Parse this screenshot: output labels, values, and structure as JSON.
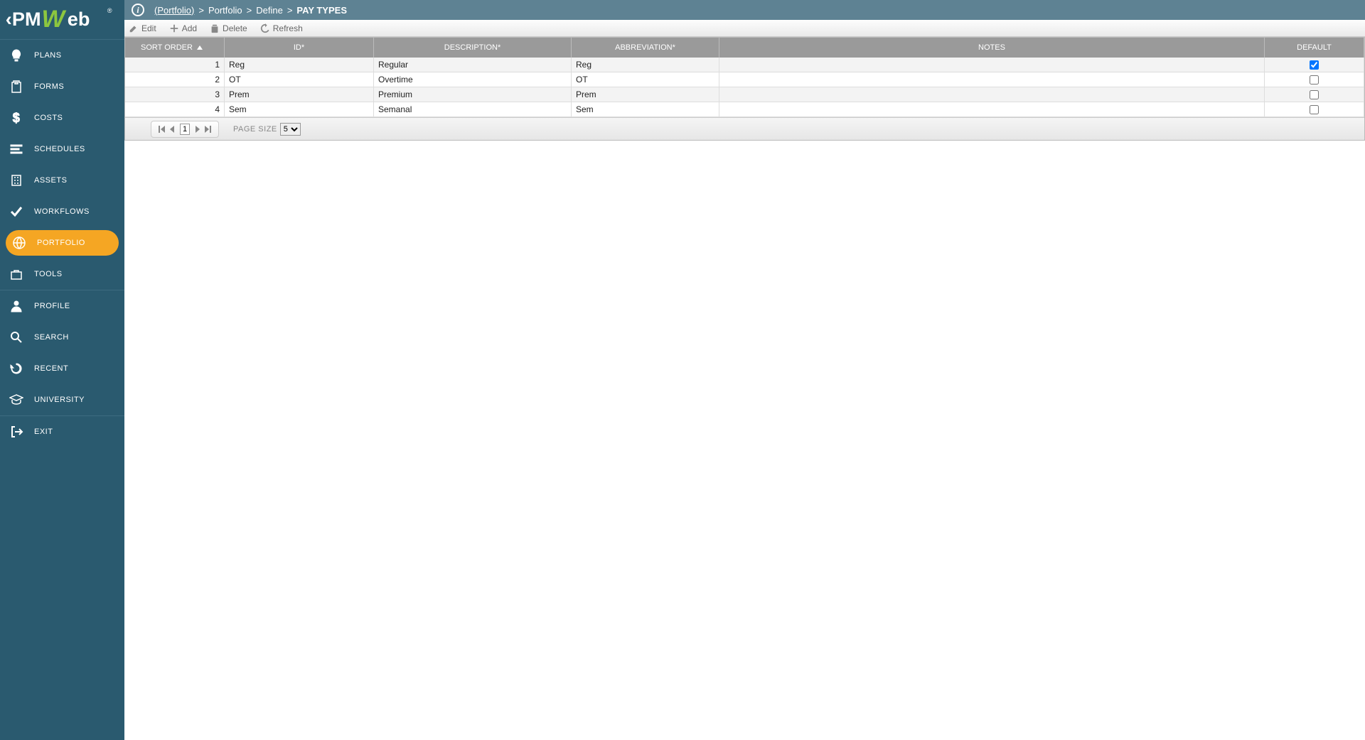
{
  "logo": {
    "brand": "PMWeb"
  },
  "sidebar": {
    "groups": [
      {
        "items": [
          {
            "label": "PLANS",
            "icon": "bulb"
          },
          {
            "label": "FORMS",
            "icon": "clipboard"
          },
          {
            "label": "COSTS",
            "icon": "dollar"
          },
          {
            "label": "SCHEDULES",
            "icon": "bars"
          },
          {
            "label": "ASSETS",
            "icon": "building"
          },
          {
            "label": "WORKFLOWS",
            "icon": "check"
          },
          {
            "label": "PORTFOLIO",
            "icon": "globe",
            "active": true
          },
          {
            "label": "TOOLS",
            "icon": "briefcase"
          }
        ]
      },
      {
        "items": [
          {
            "label": "PROFILE",
            "icon": "person"
          },
          {
            "label": "SEARCH",
            "icon": "search"
          },
          {
            "label": "RECENT",
            "icon": "history"
          },
          {
            "label": "UNIVERSITY",
            "icon": "grad"
          }
        ]
      },
      {
        "items": [
          {
            "label": "EXIT",
            "icon": "exit"
          }
        ]
      }
    ]
  },
  "breadcrumb": {
    "root": "(Portfolio)",
    "parts": [
      "Portfolio",
      "Define"
    ],
    "page": "PAY TYPES"
  },
  "toolbar": {
    "edit": "Edit",
    "add": "Add",
    "delete": "Delete",
    "refresh": "Refresh"
  },
  "grid": {
    "headers": {
      "order": "SORT ORDER",
      "id": "ID*",
      "desc": "DESCRIPTION*",
      "abbr": "ABBREVIATION*",
      "notes": "NOTES",
      "def": "DEFAULT"
    },
    "rows": [
      {
        "order": "1",
        "id": "Reg",
        "desc": "Regular",
        "abbr": "Reg",
        "notes": "",
        "def": true
      },
      {
        "order": "2",
        "id": "OT",
        "desc": "Overtime",
        "abbr": "OT",
        "notes": "",
        "def": false
      },
      {
        "order": "3",
        "id": "Prem",
        "desc": "Premium",
        "abbr": "Prem",
        "notes": "",
        "def": false
      },
      {
        "order": "4",
        "id": "Sem",
        "desc": "Semanal",
        "abbr": "Sem",
        "notes": "",
        "def": false
      }
    ]
  },
  "pager": {
    "page": "1",
    "page_size_label": "PAGE SIZE",
    "page_size": "5"
  }
}
